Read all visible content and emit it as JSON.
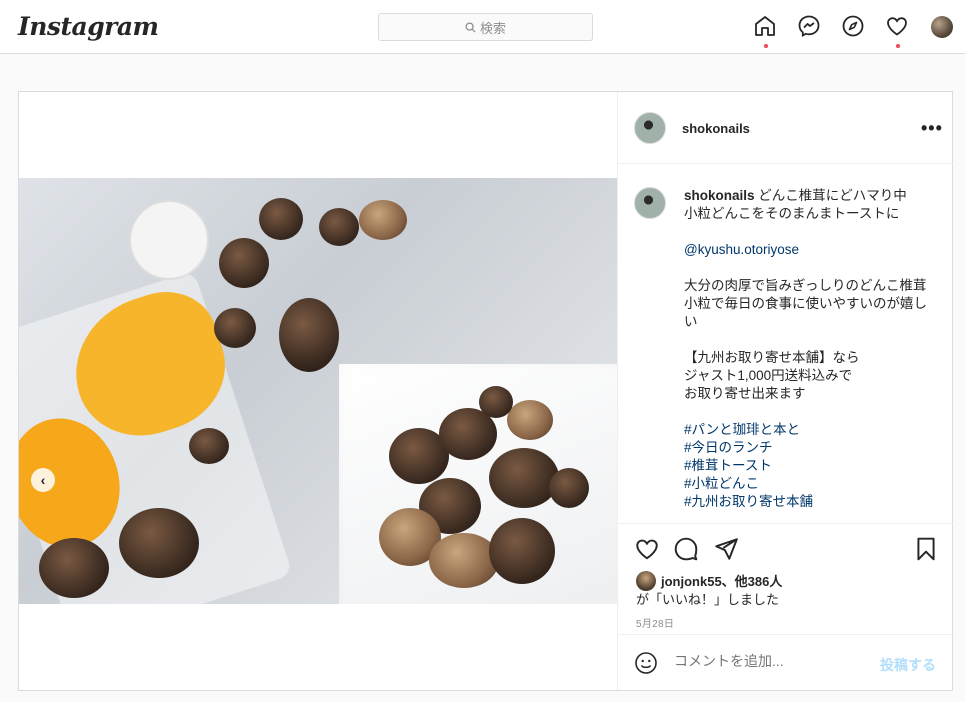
{
  "header": {
    "logo": "Instagram",
    "search_placeholder": "検索",
    "nav_icons": [
      "home-icon",
      "messenger-icon",
      "explore-icon",
      "heart-icon"
    ],
    "accent": "#ed4956"
  },
  "post": {
    "username": "shokonails",
    "caption_user": "shokonails",
    "caption_lines": [
      "どんこ椎茸にどハマり中",
      "小粒どんこをそのまんまトースト に",
      "",
      "@kyushu.otoriyose",
      "",
      "大分の肉厚で旨みぎっしりのどんこ椎茸",
      "小粒で毎日の食事に使いやすいのが嬉しい",
      "",
      "【九州お取り寄せ本舗】なら",
      "ジャスト1,000円送料込みで",
      "お取り寄せ出来ます",
      "",
      "#パンと珈琲と本と",
      "#今日のランチ",
      "#椎茸トースト",
      "#小粒どんこ",
      "#九州お取り寄せ本舗"
    ],
    "caption_first": "どんこ椎茸にどハマり中",
    "caption_second": "小粒どんこをそのまんまトーストに",
    "mention": "@kyushu.otoriyose",
    "para1a": "大分の肉厚で旨みぎっしりのどんこ椎茸",
    "para1b": "小粒で毎日の食事に使いやすいのが嬉しい",
    "para2a": "【九州お取り寄せ本舗】なら",
    "para2b": "ジャスト1,000円送料込みで",
    "para2c": "お取り寄せ出来ます",
    "tags": [
      "#パンと珈琲と本と",
      "#今日のランチ",
      "#椎茸トースト",
      "#小粒どんこ",
      "#九州お取り寄せ本舗"
    ],
    "likes_by": "jonjonk55、他386人",
    "likes_suffix": "が「いいね！」しました",
    "date": "5月28日",
    "comment_placeholder": "コメントを追加...",
    "post_button": "投稿する"
  }
}
